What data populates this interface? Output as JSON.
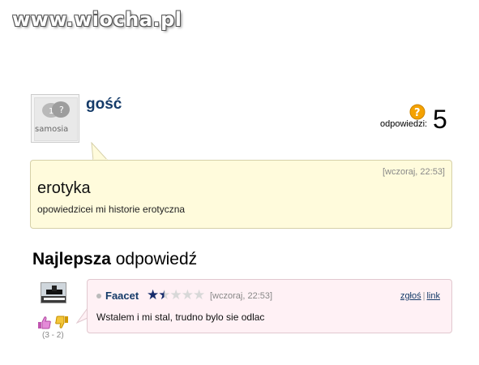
{
  "watermark": "www.wiocha.pl",
  "question": {
    "author": "gość",
    "avatar_logo": "samosia",
    "answers_label": "odpowiedzi:",
    "answers_count": "5",
    "date": "[wczoraj, 22:53]",
    "title": "erotyka",
    "body": "opowiedzicei mi historie erotyczna"
  },
  "best_answer": {
    "heading_bold": "Najlepsza",
    "heading_rest": "odpowiedź",
    "author": "Faacet",
    "rating": {
      "filled": 1.5,
      "max": 5
    },
    "date": "[wczoraj, 22:53]",
    "report_label": "zgłoś",
    "link_label": "link",
    "body": "Wstalem i mi stal, trudno bylo sie odlac",
    "votes": "(3 - 2)"
  },
  "colors": {
    "username": "#153b69",
    "question_bg": "#fffbdc",
    "answer_bg": "#fff1f5",
    "star_on": "#152b6b",
    "help_icon": "#f5a200"
  },
  "icons": [
    "help-circle-icon",
    "thumbs-up-icon",
    "thumbs-down-icon",
    "star-icon"
  ]
}
